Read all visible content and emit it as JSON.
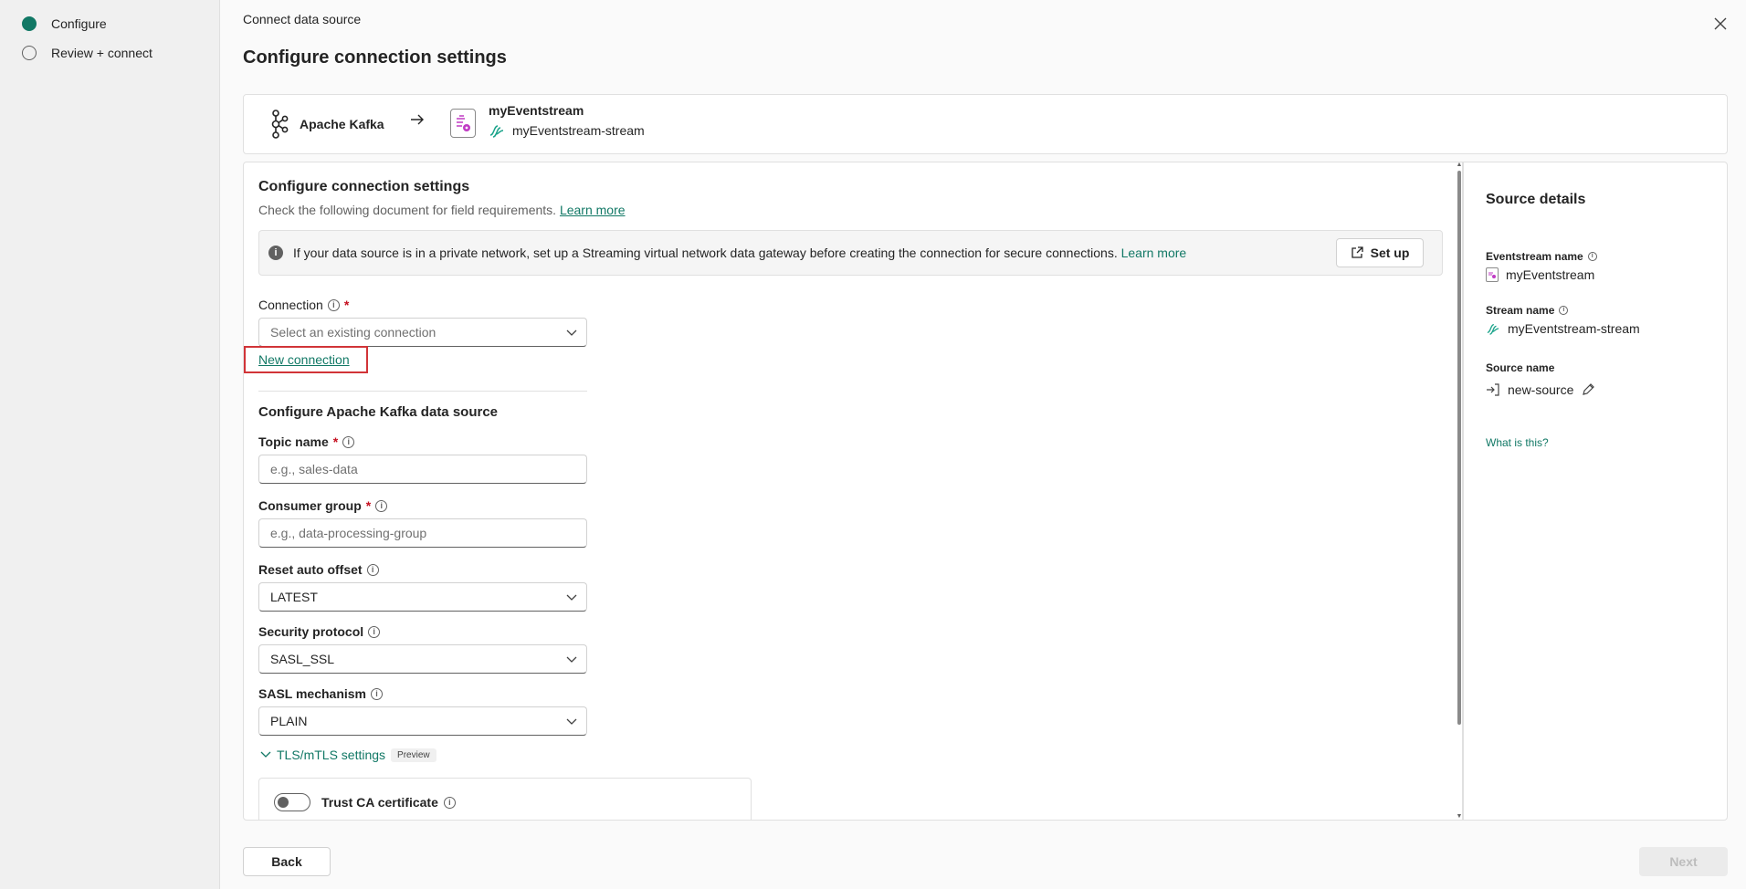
{
  "stepper": {
    "steps": [
      {
        "label": "Configure",
        "active": true
      },
      {
        "label": "Review + connect",
        "active": false
      }
    ]
  },
  "header": {
    "breadcrumb": "Connect data source",
    "title": "Configure connection settings"
  },
  "flow": {
    "source_name": "Apache Kafka",
    "eventstream_name": "myEventstream",
    "stream_name": "myEventstream-stream"
  },
  "form": {
    "heading": "Configure connection settings",
    "subtitle": "Check the following document for field requirements.",
    "learn_more": "Learn more",
    "banner": {
      "message": "If your data source is in a private network, set up a Streaming virtual network data gateway before creating the connection for secure connections.",
      "learn_more": "Learn more",
      "setup_label": "Set up"
    },
    "connection": {
      "label": "Connection",
      "required_mark": "*",
      "placeholder": "Select an existing connection",
      "new_connection": "New connection"
    },
    "kafka_section_heading": "Configure Apache Kafka data source",
    "topic": {
      "label": "Topic name",
      "required_mark": "*",
      "placeholder": "e.g., sales-data"
    },
    "consumer_group": {
      "label": "Consumer group",
      "required_mark": "*",
      "placeholder": "e.g., data-processing-group"
    },
    "reset_offset": {
      "label": "Reset auto offset",
      "value": "LATEST"
    },
    "security_protocol": {
      "label": "Security protocol",
      "value": "SASL_SSL"
    },
    "sasl_mechanism": {
      "label": "SASL mechanism",
      "value": "PLAIN"
    },
    "tls": {
      "label": "TLS/mTLS settings",
      "badge": "Preview"
    },
    "trust_ca": {
      "label": "Trust CA certificate",
      "enabled": false
    }
  },
  "details": {
    "title": "Source details",
    "eventstream_label": "Eventstream name",
    "eventstream_value": "myEventstream",
    "stream_label": "Stream name",
    "stream_value": "myEventstream-stream",
    "source_label": "Source name",
    "source_value": "new-source",
    "what_is_this": "What is this?"
  },
  "footer": {
    "back": "Back",
    "next": "Next"
  },
  "colors": {
    "accent": "#117865",
    "error": "#c50f1f",
    "highlight_box": "#d13438",
    "eventstream_icon": "#c03bc4"
  }
}
